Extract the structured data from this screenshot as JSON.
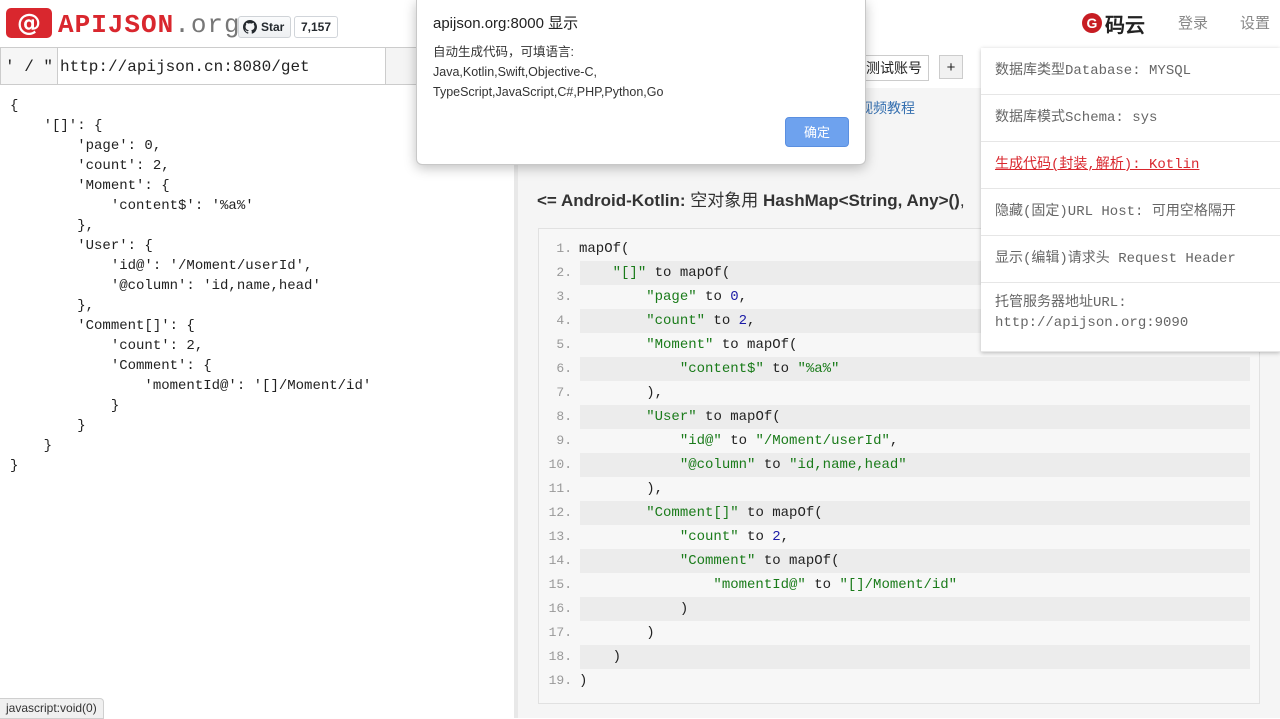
{
  "header": {
    "logo_symbol": "@",
    "logo_name": "APIJSON",
    "logo_tld": ".org",
    "github_star_label": "Star",
    "github_star_count": "7,157",
    "gitee_label": "码云",
    "login_label": "登录",
    "settings_label": "设置"
  },
  "urlbar": {
    "quote_button": "' / \"",
    "url_value": "http://apijson.cn:8080/get",
    "test_account_label": "测试账号",
    "plus_label": "+"
  },
  "json_request": [
    "{",
    "    '[]': {",
    "        'page': 0,",
    "        'count': 2,",
    "        'Moment': {",
    "            'content$': '%a%'",
    "        },",
    "        'User': {",
    "            'id@': '/Moment/userId',",
    "            '@column': 'id,name,head'",
    "        },",
    "        'Comment[]': {",
    "            'count': 2,",
    "            'Comment': {",
    "                'momentId@': '[]/Moment/id'",
    "            }",
    "        }",
    "    }",
    "}"
  ],
  "right": {
    "video_link": "视频教程",
    "kotlin_heading_bold1": "<= Android-Kotlin:",
    "kotlin_heading_text1": " 空对象用 ",
    "kotlin_heading_bold2": "HashMap<String, Any>()",
    "kotlin_heading_text2": ","
  },
  "code_lines": [
    {
      "n": "1.",
      "html": "mapOf("
    },
    {
      "n": "2.",
      "html": "    <span class='str'>\"[]\"</span> to mapOf("
    },
    {
      "n": "3.",
      "html": "        <span class='str'>\"page\"</span> to <span class='num'>0</span>,"
    },
    {
      "n": "4.",
      "html": "        <span class='str'>\"count\"</span> to <span class='num'>2</span>,"
    },
    {
      "n": "5.",
      "html": "        <span class='str'>\"Moment\"</span> to mapOf("
    },
    {
      "n": "6.",
      "html": "            <span class='str'>\"content$\"</span> to <span class='str'>\"%a%\"</span>"
    },
    {
      "n": "7.",
      "html": "        ),"
    },
    {
      "n": "8.",
      "html": "        <span class='str'>\"User\"</span> to mapOf("
    },
    {
      "n": "9.",
      "html": "            <span class='str'>\"id@\"</span> to <span class='str'>\"/Moment/userId\"</span>,"
    },
    {
      "n": "10.",
      "html": "            <span class='str'>\"@column\"</span> to <span class='str'>\"id,name,head\"</span>"
    },
    {
      "n": "11.",
      "html": "        ),"
    },
    {
      "n": "12.",
      "html": "        <span class='str'>\"Comment[]\"</span> to mapOf("
    },
    {
      "n": "13.",
      "html": "            <span class='str'>\"count\"</span> to <span class='num'>2</span>,"
    },
    {
      "n": "14.",
      "html": "            <span class='str'>\"Comment\"</span> to mapOf("
    },
    {
      "n": "15.",
      "html": "                <span class='str'>\"momentId@\"</span> to <span class='str'>\"[]/Moment/id\"</span>"
    },
    {
      "n": "16.",
      "html": "            )"
    },
    {
      "n": "17.",
      "html": "        )"
    },
    {
      "n": "18.",
      "html": "    )"
    },
    {
      "n": "19.",
      "html": ")"
    }
  ],
  "settings_menu": [
    {
      "label": "数据库类型Database: MYSQL",
      "active": false
    },
    {
      "label": "数据库模式Schema: sys",
      "active": false
    },
    {
      "label": "生成代码(封装,解析): Kotlin",
      "active": true
    },
    {
      "label": "隐藏(固定)URL Host: 可用空格隔开",
      "active": false
    },
    {
      "label": "显示(编辑)请求头 Request Header",
      "active": false
    },
    {
      "label": "托管服务器地址URL:\nhttp://apijson.org:9090",
      "active": false
    }
  ],
  "dialog": {
    "title": "apijson.org:8000 显示",
    "message_line1": "自动生成代码，可填语言:",
    "message_line2": "Java,Kotlin,Swift,Objective-C,",
    "message_line3": "TypeScript,JavaScript,C#,PHP,Python,Go",
    "ok_label": "确定"
  },
  "statusbar": {
    "text": "javascript:void(0)"
  },
  "colors": {
    "brand_red": "#d9272e",
    "ok_button": "#6ea2ee",
    "string_green": "#1a7b1a",
    "link_blue": "#3670b0"
  }
}
